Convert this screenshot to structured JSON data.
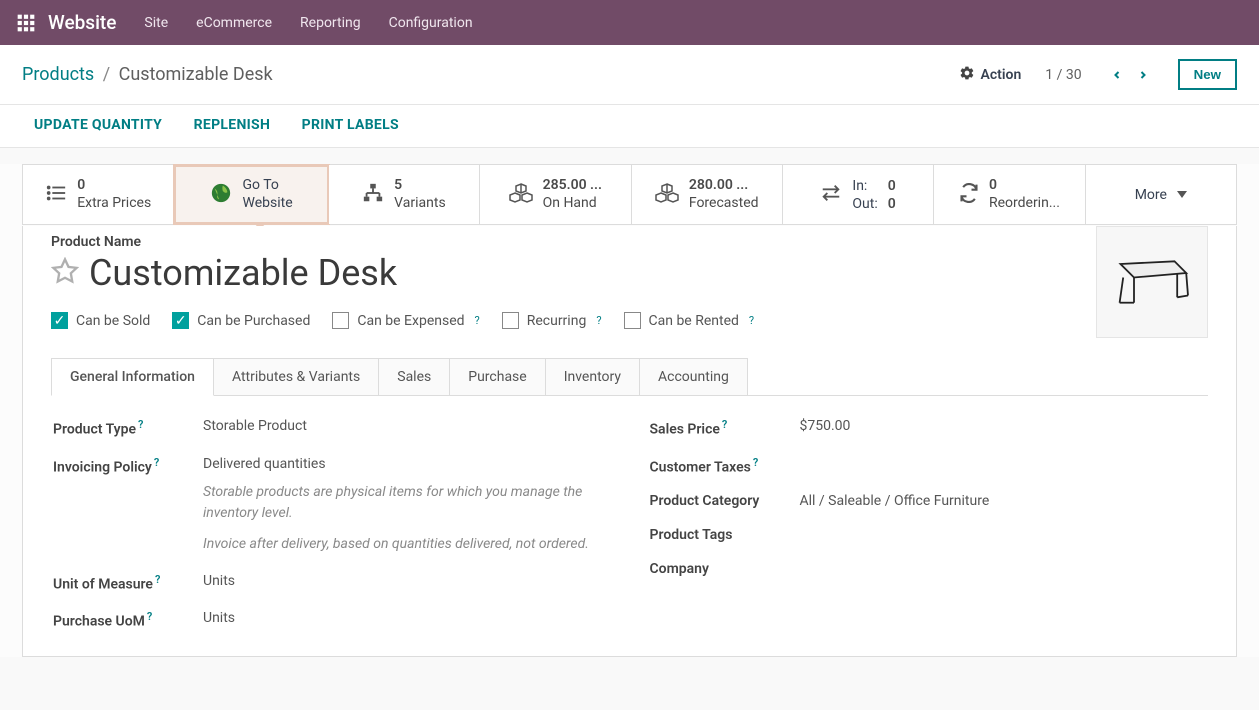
{
  "topnav": {
    "brand": "Website",
    "menu": [
      "Site",
      "eCommerce",
      "Reporting",
      "Configuration"
    ]
  },
  "pagebar": {
    "breadcrumb_link": "Products",
    "breadcrumb_current": "Customizable Desk",
    "action_label": "Action",
    "pager": "1 / 30",
    "new_label": "New"
  },
  "actionlinks": [
    "UPDATE QUANTITY",
    "REPLENISH",
    "PRINT LABELS"
  ],
  "stats": {
    "extra_prices": {
      "val": "0",
      "lbl": "Extra Prices"
    },
    "go_to_website": {
      "l1": "Go To",
      "l2": "Website"
    },
    "variants": {
      "val": "5",
      "lbl": "Variants"
    },
    "on_hand": {
      "val": "285.00 ...",
      "lbl": "On Hand"
    },
    "forecasted": {
      "val": "280.00 ...",
      "lbl": "Forecasted"
    },
    "io": {
      "in_lbl": "In:",
      "in_val": "0",
      "out_lbl": "Out:",
      "out_val": "0"
    },
    "reordering": {
      "val": "0",
      "lbl": "Reorderin..."
    },
    "more": "More"
  },
  "form": {
    "product_name_label": "Product Name",
    "product_name": "Customizable Desk",
    "checks": {
      "sold": "Can be Sold",
      "purchased": "Can be Purchased",
      "expensed": "Can be Expensed",
      "recurring": "Recurring",
      "rented": "Can be Rented"
    },
    "tabs": [
      "General Information",
      "Attributes & Variants",
      "Sales",
      "Purchase",
      "Inventory",
      "Accounting"
    ]
  },
  "details": {
    "left": {
      "product_type_label": "Product Type",
      "product_type": "Storable Product",
      "invoicing_policy_label": "Invoicing Policy",
      "invoicing_policy": "Delivered quantities",
      "note1": "Storable products are physical items for which you manage the inventory level.",
      "note2": "Invoice after delivery, based on quantities delivered, not ordered.",
      "uom_label": "Unit of Measure",
      "uom": "Units",
      "purchase_uom_label": "Purchase UoM",
      "purchase_uom": "Units"
    },
    "right": {
      "sales_price_label": "Sales Price",
      "sales_price": "$750.00",
      "customer_taxes_label": "Customer Taxes",
      "product_category_label": "Product Category",
      "product_category": "All / Saleable / Office Furniture",
      "product_tags_label": "Product Tags",
      "company_label": "Company"
    }
  }
}
